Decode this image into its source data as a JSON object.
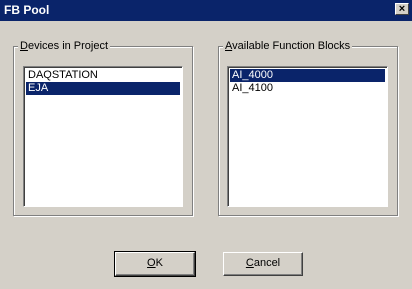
{
  "window": {
    "title": "FB Pool",
    "close_glyph": "×"
  },
  "devices": {
    "label_accel": "D",
    "label_rest": "evices in Project",
    "items": [
      {
        "label": "DAQSTATION",
        "selected": false
      },
      {
        "label": "EJA",
        "selected": true
      }
    ]
  },
  "function_blocks": {
    "label_accel": "A",
    "label_rest": "vailable Function Blocks",
    "items": [
      {
        "label": "AI_4000",
        "selected": true
      },
      {
        "label": "AI_4100",
        "selected": false
      }
    ]
  },
  "buttons": {
    "ok_accel": "O",
    "ok_rest": "K",
    "cancel_accel": "C",
    "cancel_rest": "ancel"
  }
}
